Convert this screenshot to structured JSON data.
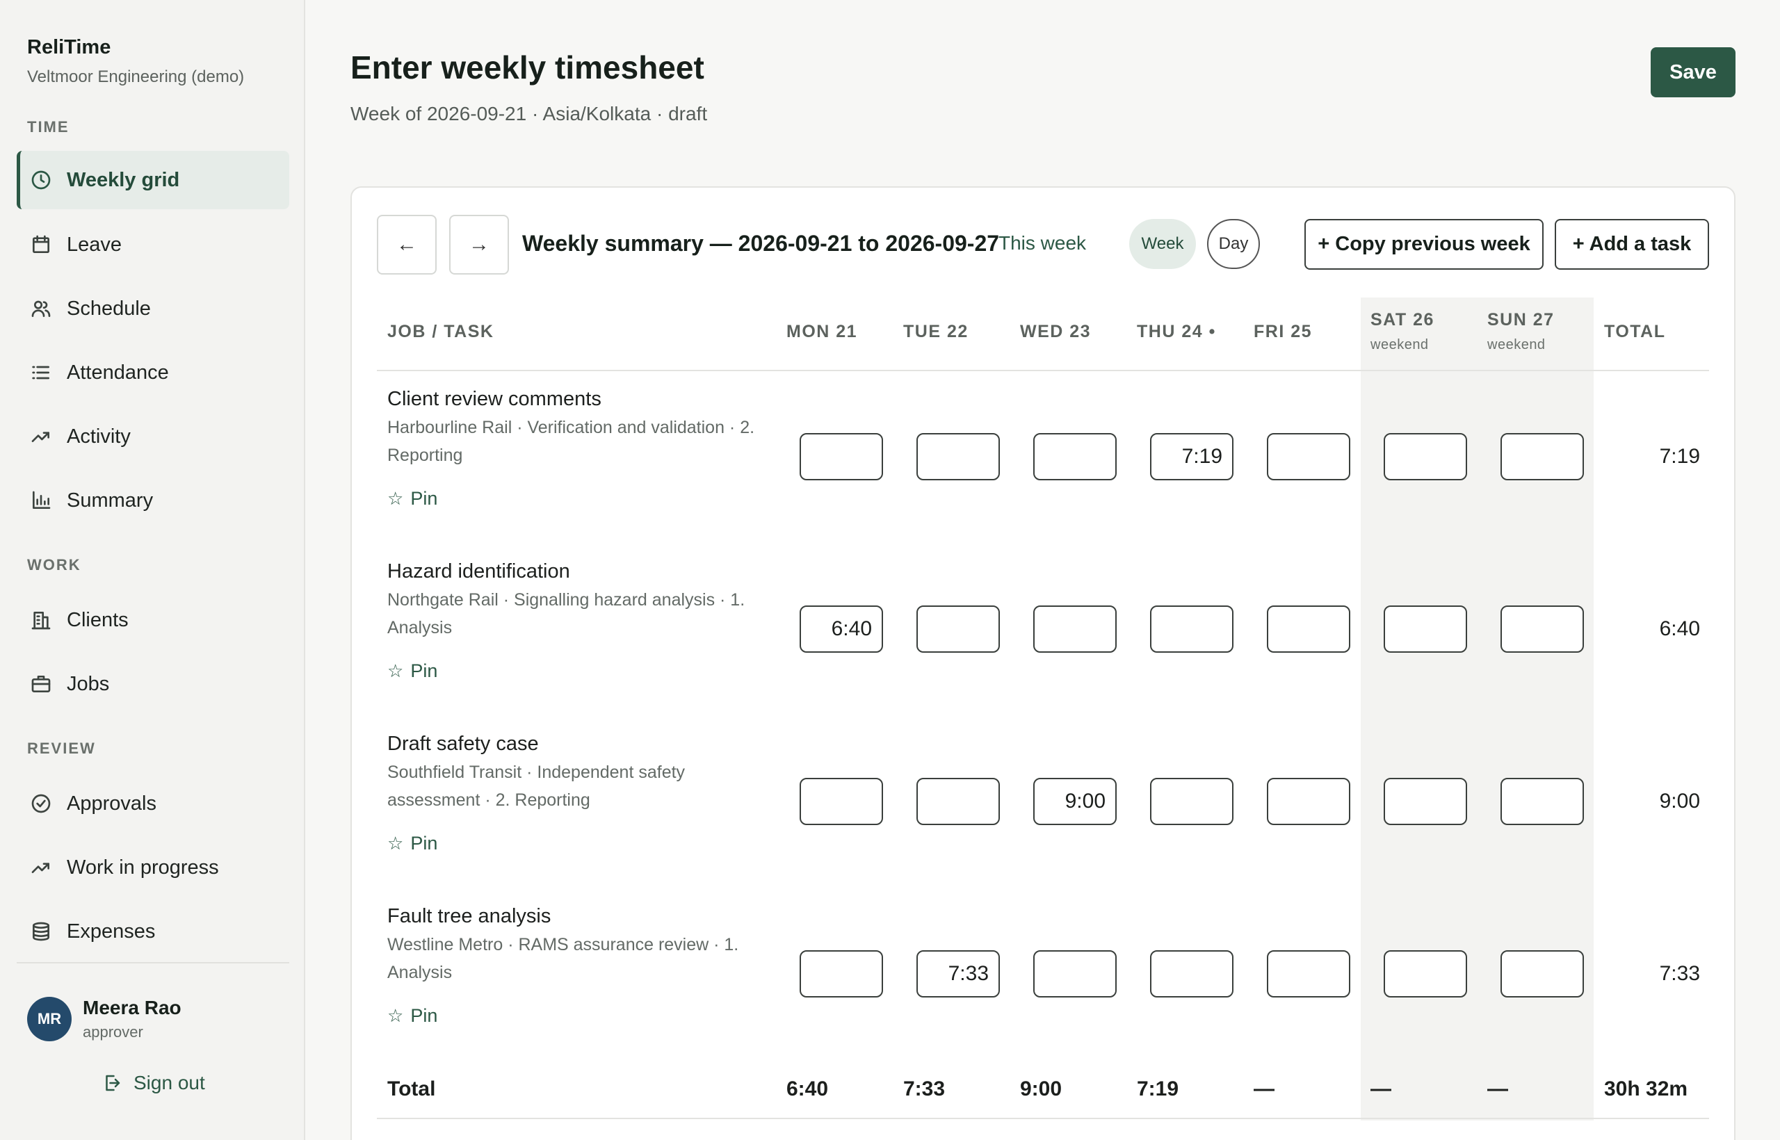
{
  "brand": {
    "name": "ReliTime",
    "org": "Veltmoor Engineering (demo)"
  },
  "nav": {
    "sections": [
      "TIME",
      "WORK",
      "REVIEW"
    ],
    "items": [
      {
        "label": "Weekly grid",
        "icon": "clock-icon",
        "active": true
      },
      {
        "label": "Leave",
        "icon": "calendar-icon"
      },
      {
        "label": "Schedule",
        "icon": "people-icon"
      },
      {
        "label": "Attendance",
        "icon": "list-icon"
      },
      {
        "label": "Activity",
        "icon": "trend-icon"
      },
      {
        "label": "Summary",
        "icon": "bar-chart-icon"
      },
      {
        "label": "Clients",
        "icon": "building-icon"
      },
      {
        "label": "Jobs",
        "icon": "briefcase-icon"
      },
      {
        "label": "Approvals",
        "icon": "check-circle-icon"
      },
      {
        "label": "Work in progress",
        "icon": "trend-icon"
      },
      {
        "label": "Expenses",
        "icon": "database-icon"
      }
    ]
  },
  "user": {
    "initials": "MR",
    "name": "Meera Rao",
    "role": "approver",
    "signout": "Sign out"
  },
  "header": {
    "title": "Enter weekly timesheet",
    "subtitle": "Week of 2026-09-21 · Asia/Kolkata · draft",
    "save": "Save"
  },
  "toolbar": {
    "prev": "←",
    "next": "→",
    "summary": "Weekly summary — 2026-09-21 to 2026-09-27",
    "this_week": "This week",
    "week": "Week",
    "day": "Day",
    "copy": "+ Copy previous week",
    "add": "+ Add a task"
  },
  "columns": {
    "task": "JOB / TASK",
    "days": [
      "MON 21",
      "TUE 22",
      "WED 23",
      "THU 24 •",
      "FRI 25",
      "SAT 26",
      "SUN 27"
    ],
    "weekend_label": "weekend",
    "total": "TOTAL"
  },
  "pin_label": "Pin",
  "rows": [
    {
      "title": "Client review comments",
      "meta": "Harbourline Rail · Verification and validation · 2. Reporting",
      "cells": [
        "",
        "",
        "",
        "7:19",
        "",
        "",
        ""
      ],
      "total": "7:19"
    },
    {
      "title": "Hazard identification",
      "meta": "Northgate Rail · Signalling hazard analysis · 1. Analysis",
      "cells": [
        "6:40",
        "",
        "",
        "",
        "",
        "",
        ""
      ],
      "total": "6:40"
    },
    {
      "title": "Draft safety case",
      "meta": "Southfield Transit · Independent safety assessment · 2. Reporting",
      "cells": [
        "",
        "",
        "9:00",
        "",
        "",
        "",
        ""
      ],
      "total": "9:00"
    },
    {
      "title": "Fault tree analysis",
      "meta": "Westline Metro · RAMS assurance review · 1. Analysis",
      "cells": [
        "",
        "7:33",
        "",
        "",
        "",
        "",
        ""
      ],
      "total": "7:33"
    }
  ],
  "totals": {
    "label": "Total",
    "days": [
      "6:40",
      "7:33",
      "9:00",
      "7:19",
      "—",
      "—",
      "—"
    ],
    "grand": "30h 32m"
  }
}
